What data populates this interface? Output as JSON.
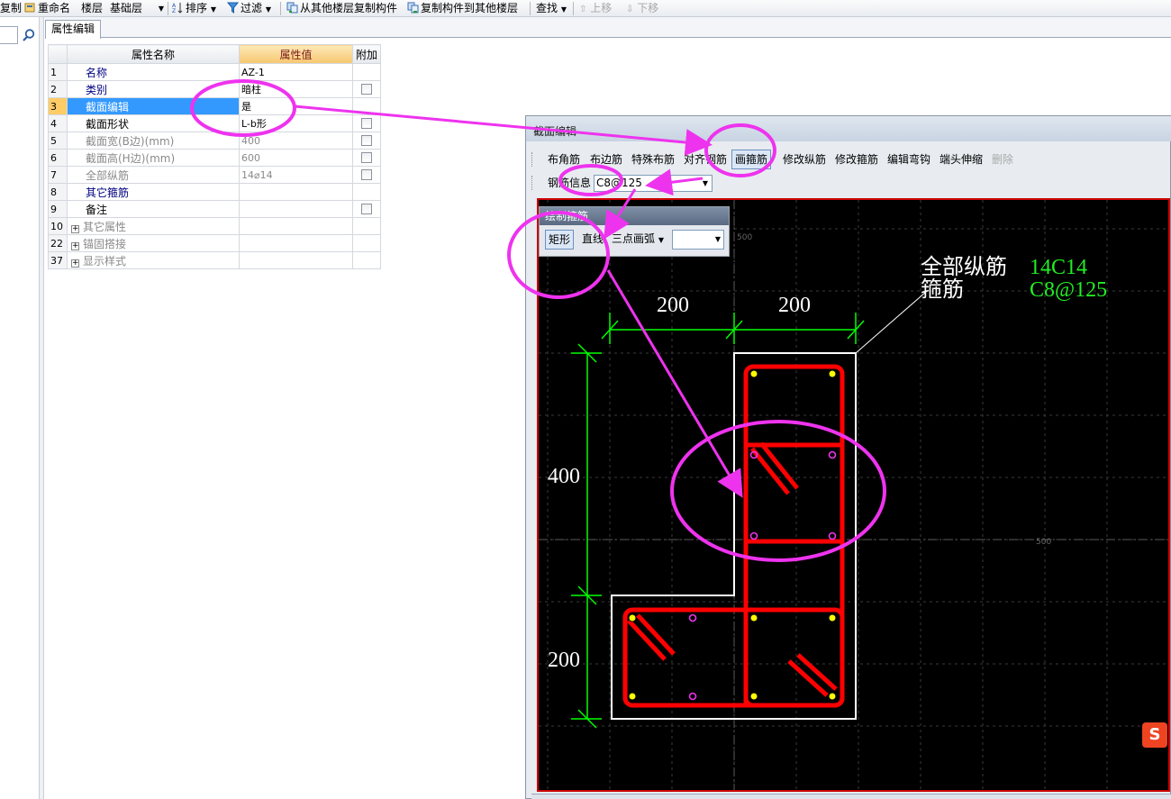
{
  "toolbar": {
    "items": [
      {
        "label": "复制"
      },
      {
        "label": "重命名"
      },
      {
        "label": "楼层"
      },
      {
        "label": "基础层"
      },
      {
        "label": "排序"
      },
      {
        "label": "过滤"
      },
      {
        "label": "从其他楼层复制构件"
      },
      {
        "label": "复制构件到其他楼层"
      },
      {
        "label": "查找"
      },
      {
        "label": "上移"
      },
      {
        "label": "下移"
      }
    ]
  },
  "property_tab": {
    "label": "属性编辑"
  },
  "grid": {
    "headers": {
      "name": "属性名称",
      "value": "属性值",
      "extra": "附加"
    },
    "rows": [
      {
        "num": "1",
        "name": "名称",
        "value": "AZ-1"
      },
      {
        "num": "2",
        "name": "类别",
        "value": "暗柱"
      },
      {
        "num": "3",
        "name": "截面编辑",
        "value": "是"
      },
      {
        "num": "4",
        "name": "截面形状",
        "value": "L-b形"
      },
      {
        "num": "5",
        "name": "截面宽(B边)(mm)",
        "value": "400"
      },
      {
        "num": "6",
        "name": "截面高(H边)(mm)",
        "value": "600"
      },
      {
        "num": "7",
        "name": "全部纵筋",
        "value": "14⌀14"
      },
      {
        "num": "8",
        "name": "其它箍筋",
        "value": ""
      },
      {
        "num": "9",
        "name": "备注",
        "value": ""
      },
      {
        "num": "10",
        "name": "其它属性",
        "value": ""
      },
      {
        "num": "22",
        "name": "锚固搭接",
        "value": ""
      },
      {
        "num": "37",
        "name": "显示样式",
        "value": ""
      }
    ]
  },
  "editor": {
    "title": "截面编辑",
    "toolbar": [
      {
        "label": "布角筋"
      },
      {
        "label": "布边筋"
      },
      {
        "label": "特殊布筋"
      },
      {
        "label": "对齐钢筋"
      },
      {
        "label": "画箍筋"
      },
      {
        "label": "修改纵筋"
      },
      {
        "label": "修改箍筋"
      },
      {
        "label": "编辑弯钩"
      },
      {
        "label": "端头伸缩"
      },
      {
        "label": "删除"
      }
    ],
    "steel_info_label": "钢筋信息",
    "steel_info_value": "C8@125",
    "popup": {
      "title": "绘制箍筋",
      "buttons": [
        {
          "label": "矩形"
        },
        {
          "label": "直线"
        },
        {
          "label": "三点画弧"
        }
      ]
    },
    "canvas": {
      "dims": {
        "top_left": "200",
        "top_right": "200",
        "left_upper": "400",
        "left_lower": "200"
      },
      "label_long_bars": "全部纵筋",
      "label_long_bars_value": "14C14",
      "label_stirrup": "箍筋",
      "label_stirrup_value": "C8@125",
      "grid_labels": {
        "axis_a": "500",
        "axis_b": "500"
      }
    }
  },
  "ime_badge": "S",
  "colors": {
    "stirrup": "#ff0000",
    "dimension": "#00ff00",
    "outline": "#ffffff",
    "annotation": "#ee33ee",
    "selection": "#3399ff",
    "header_value": "#f6c770"
  }
}
